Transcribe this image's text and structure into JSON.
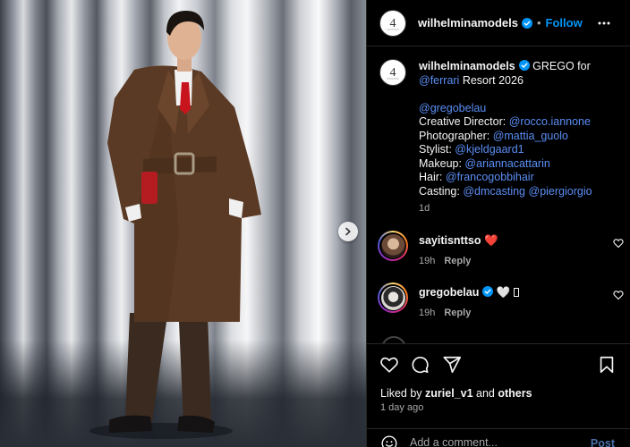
{
  "post": {
    "account": "wilhelminamodels",
    "follow_label": "Follow",
    "separator": "•",
    "logo_text": "4"
  },
  "caption": {
    "username": "wilhelminamodels",
    "line1": " GREGO for",
    "ferrari": "@ferrari",
    "resort": " Resort 2026",
    "model": "@gregobelau",
    "creative_label": "Creative Director: ",
    "creative": "@rocco.iannone",
    "photographer_label": "Photographer: ",
    "photographer": "@mattia_guolo",
    "stylist_label": "Stylist: ",
    "stylist": "@kjeldgaard1",
    "makeup_label": "Makeup: ",
    "makeup": "@ariannacattarin",
    "hair_label": "Hair: ",
    "hair": "@francogobbihair",
    "casting_label": "Casting: ",
    "casting1": "@dmcasting",
    "casting2": "@piergiorgio",
    "time": "1d"
  },
  "comments": [
    {
      "user": "sayitisnttso",
      "emoji": "❤️",
      "time": "19h",
      "reply": "Reply"
    },
    {
      "user": "gregobelau",
      "emoji": "🤍 ",
      "time": "19h",
      "reply": "Reply"
    }
  ],
  "footer": {
    "liked_by_prefix": "Liked by ",
    "liked_by_user": "zuriel_v1",
    "liked_by_suffix_and": " and ",
    "liked_by_others": "others",
    "date": "1 day ago",
    "comment_placeholder": "Add a comment...",
    "post_label": "Post"
  },
  "colors": {
    "accent_blue": "#0095f6",
    "link_blue": "#5b8ef5",
    "heart_red": "#ed2a3d"
  }
}
